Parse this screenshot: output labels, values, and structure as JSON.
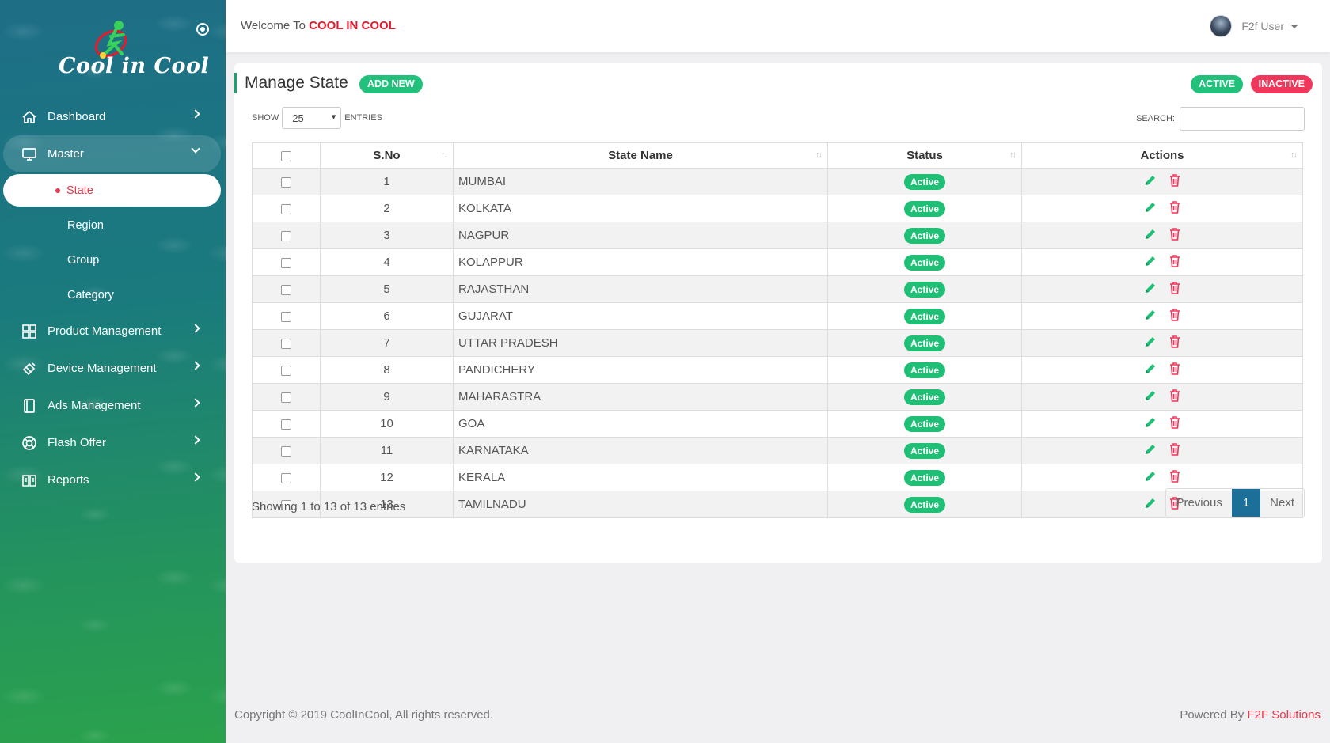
{
  "brand": {
    "name": "Cool in Cool"
  },
  "header": {
    "welcome_prefix": "Welcome To",
    "welcome_brand": "COOL IN COOL",
    "user_name": "F2f User"
  },
  "sidebar": {
    "items": [
      {
        "label": "Dashboard",
        "icon": "home-icon"
      },
      {
        "label": "Master",
        "icon": "monitor-icon"
      },
      {
        "label": "Product Management",
        "icon": "grid-icon"
      },
      {
        "label": "Device Management",
        "icon": "device-icon"
      },
      {
        "label": "Ads Management",
        "icon": "book-icon"
      },
      {
        "label": "Flash Offer",
        "icon": "lifebuoy-icon"
      },
      {
        "label": "Reports",
        "icon": "reports-icon"
      }
    ],
    "master_sub": [
      "State",
      "Region",
      "Group",
      "Category"
    ]
  },
  "page": {
    "title": "Manage State",
    "add_new": "ADD NEW",
    "filter_active": "ACTIVE",
    "filter_inactive": "INACTIVE",
    "show_label": "SHOW",
    "entries_value": "25",
    "entries_label": "ENTRIES",
    "search_label": "SEARCH:",
    "search_value": ""
  },
  "table": {
    "columns": [
      "S.No",
      "State Name",
      "Status",
      "Actions"
    ],
    "rows": [
      {
        "sno": "1",
        "name": "MUMBAI",
        "status": "Active"
      },
      {
        "sno": "2",
        "name": "KOLKATA",
        "status": "Active"
      },
      {
        "sno": "3",
        "name": "NAGPUR",
        "status": "Active"
      },
      {
        "sno": "4",
        "name": "KOLAPPUR",
        "status": "Active"
      },
      {
        "sno": "5",
        "name": "RAJASTHAN",
        "status": "Active"
      },
      {
        "sno": "6",
        "name": "GUJARAT",
        "status": "Active"
      },
      {
        "sno": "7",
        "name": "UTTAR PRADESH",
        "status": "Active"
      },
      {
        "sno": "8",
        "name": "PANDICHERY",
        "status": "Active"
      },
      {
        "sno": "9",
        "name": "MAHARASTRA",
        "status": "Active"
      },
      {
        "sno": "10",
        "name": "GOA",
        "status": "Active"
      },
      {
        "sno": "11",
        "name": "KARNATAKA",
        "status": "Active"
      },
      {
        "sno": "12",
        "name": "KERALA",
        "status": "Active"
      },
      {
        "sno": "13",
        "name": "TAMILNADU",
        "status": "Active"
      }
    ]
  },
  "pagination": {
    "info": "Showing 1 to 13 of 13 entries",
    "previous": "Previous",
    "current": "1",
    "next": "Next"
  },
  "footer": {
    "copyright": "Copyright © 2019 CoolInCool, All rights reserved.",
    "powered_prefix": "Powered By",
    "powered_brand": "F2F Solutions"
  },
  "colors": {
    "accent_green": "#21c17c",
    "accent_red": "#f0365a",
    "brand_red": "#e8192c",
    "pager_blue": "#1b6f99"
  }
}
